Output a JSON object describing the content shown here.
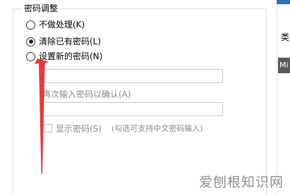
{
  "group": {
    "title": "密码调整"
  },
  "options": [
    {
      "label": "不做处理(K)",
      "checked": false
    },
    {
      "label": "清除已有密码(L)",
      "checked": true
    },
    {
      "label": "设置新的密码(N)",
      "checked": false
    }
  ],
  "fields": {
    "new_password_value": "",
    "confirm_label": "再次输入密码以确认(A)",
    "confirm_password_value": ""
  },
  "show_password": {
    "label": "显示密码(S)",
    "hint": "(勾选可支持中文密码输入)",
    "checked": false
  },
  "right_panel": {
    "text_1": "类",
    "text_2": "Mi"
  },
  "annotation": {
    "arrow_color": "#e8383d"
  },
  "watermark": {
    "text": "爱刨根知识网"
  }
}
